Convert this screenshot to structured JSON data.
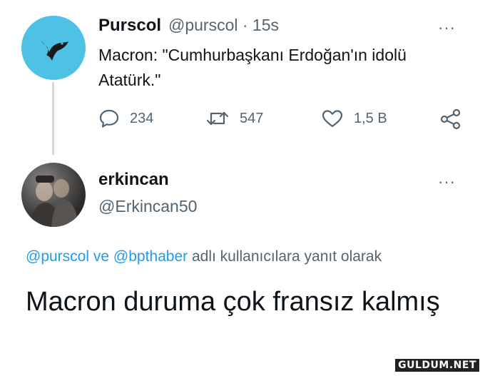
{
  "tweet": {
    "display_name": "Purscol",
    "handle_time": "@purscol · 15s",
    "text": "Macron: \"Cumhurbaşkanı Erdoğan'ın idolü Atatürk.\"",
    "more": "···",
    "avatar_icon": "bird-icon",
    "accent": "#4ec2e4",
    "actions": {
      "replies": "234",
      "retweets": "547",
      "likes": "1,5 B"
    }
  },
  "reply": {
    "display_name": "erkincan",
    "handle": "@Erkincan50",
    "more": "···",
    "replying_mention_1": "@purscol",
    "replying_joiner": "ve",
    "replying_mention_2": "@bpthaber",
    "replying_suffix": "adlı kullanıcılara yanıt olarak",
    "text": "Macron duruma çok fransız kalmış"
  },
  "watermark": "GULDUM.NET",
  "colors": {
    "mention": "#1d9bf0",
    "secondary_text": "#536471",
    "thread_line": "#cfd9de"
  }
}
